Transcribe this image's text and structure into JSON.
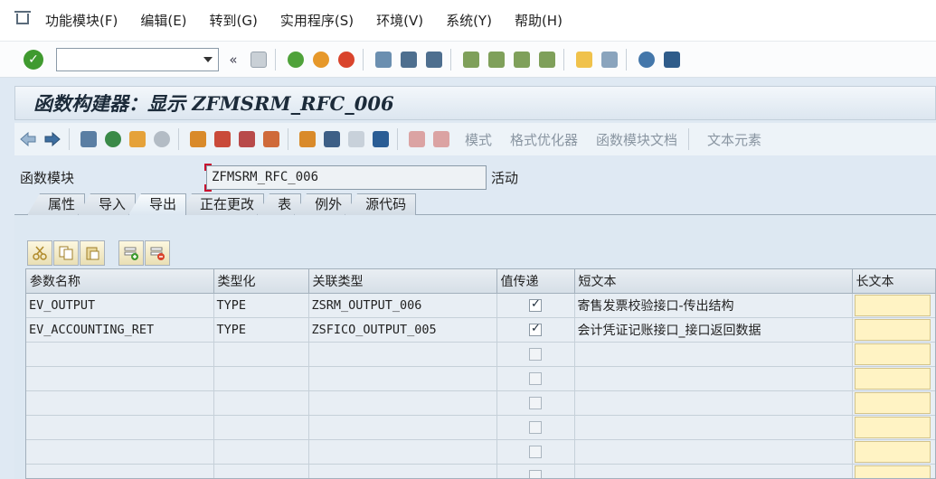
{
  "menu": {
    "items": [
      "功能模块(F)",
      "编辑(E)",
      "转到(G)",
      "实用程序(S)",
      "环境(V)",
      "系统(Y)",
      "帮助(H)"
    ]
  },
  "toolbar": {
    "command_value": "",
    "back_glyph": "«"
  },
  "title": "函数构建器：显示 ZFMSRM_RFC_006",
  "app_toolbar": {
    "texts": [
      "模式",
      "格式优化器",
      "函数模块文档",
      "文本元素"
    ]
  },
  "form": {
    "label": "函数模块",
    "value": "ZFMSRM_RFC_006",
    "status": "活动"
  },
  "tabs": [
    "属性",
    "导入",
    "导出",
    "正在更改",
    "表",
    "例外",
    "源代码"
  ],
  "active_tab": "导出",
  "table": {
    "headers": [
      "参数名称",
      "类型化",
      "关联类型",
      "值传递",
      "短文本",
      "长文本"
    ],
    "rows": [
      {
        "name": "EV_OUTPUT",
        "typing": "TYPE",
        "assoc_type": "ZSRM_OUTPUT_006",
        "pass_value": true,
        "short_text": "寄售发票校验接口-传出结构"
      },
      {
        "name": "EV_ACCOUNTING_RET",
        "typing": "TYPE",
        "assoc_type": "ZSFICO_OUTPUT_005",
        "pass_value": true,
        "short_text": "会计凭证记账接口_接口返回数据"
      }
    ]
  },
  "colors": {
    "accent_green": "#3f9a2f",
    "panel_bg": "#dde8f2",
    "long_text_fill": "#fff3c4"
  }
}
